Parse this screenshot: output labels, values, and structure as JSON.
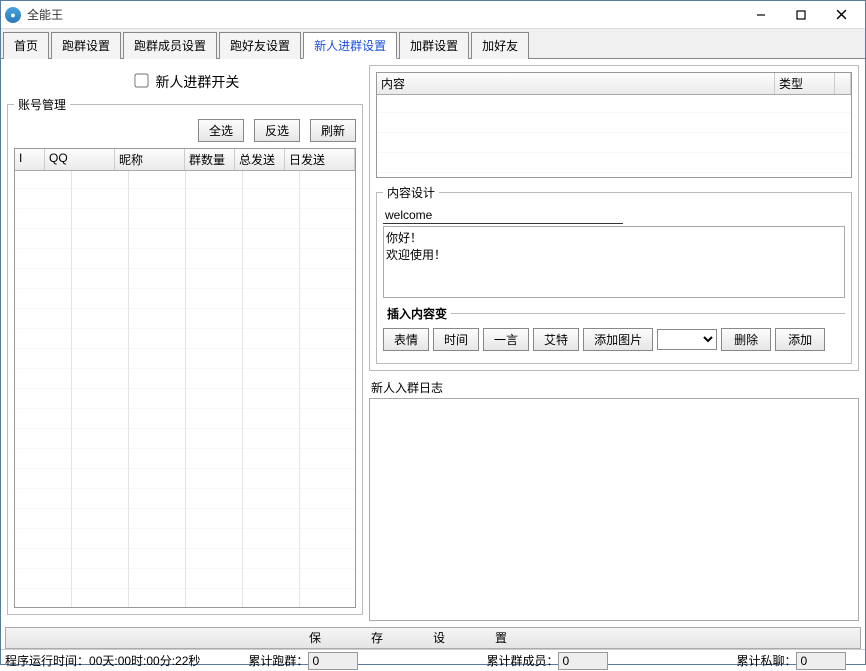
{
  "window": {
    "title": "全能王"
  },
  "tabs": [
    "首页",
    "跑群设置",
    "跑群成员设置",
    "跑好友设置",
    "新人进群设置",
    "加群设置",
    "加好友"
  ],
  "active_tab_index": 4,
  "switch_label": "新人进群开关",
  "account": {
    "legend": "账号管理",
    "select_all": "全选",
    "invert": "反选",
    "refresh": "刷新",
    "columns": [
      "I",
      "QQ",
      "昵称",
      "群数量",
      "总发送",
      "日发送"
    ]
  },
  "content_table": {
    "columns": [
      "内容",
      "类型"
    ]
  },
  "content_set": {
    "legend": "内容设计",
    "title_value": "welcome",
    "message_value": "你好！\n欢迎使用！"
  },
  "insert": {
    "legend": "插入内容变",
    "emoji": "表情",
    "time": "时间",
    "oneword": "一言",
    "at": "艾特",
    "add_image": "添加图片",
    "delete": "删除",
    "add": "添加"
  },
  "log_label": "新人入群日志",
  "savebar_text": "保存设置",
  "status": {
    "runtime_label": "程序运行时间：",
    "runtime_value": "00天:00时:00分:22秒",
    "run_group_label": "累计跑群：",
    "run_group_value": "0",
    "members_label": "累计群成员：",
    "members_value": "0",
    "pm_label": "累计私聊：",
    "pm_value": "0"
  }
}
